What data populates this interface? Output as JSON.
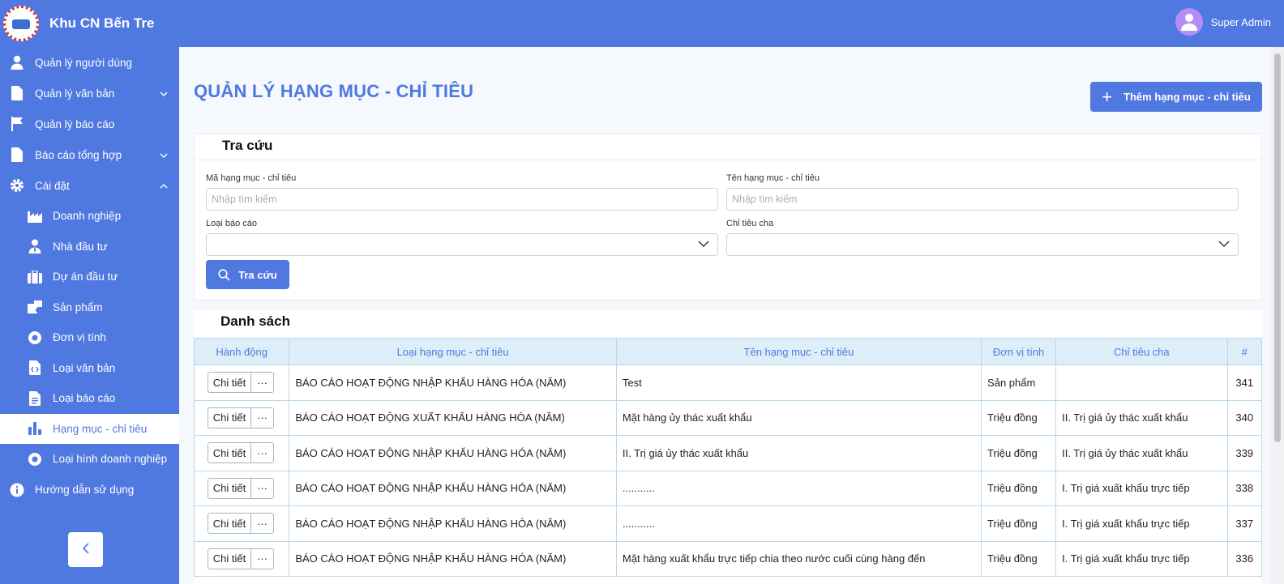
{
  "app": {
    "name": "Khu CN Bến Tre"
  },
  "user": {
    "name": "Super Admin"
  },
  "sidebar": {
    "items": [
      {
        "label": "Quản lý người dùng"
      },
      {
        "label": "Quản lý văn bản"
      },
      {
        "label": "Quản lý báo cáo"
      },
      {
        "label": "Báo cáo tổng hợp"
      },
      {
        "label": "Cài đặt"
      }
    ],
    "sub_items": [
      {
        "label": "Doanh nghiệp"
      },
      {
        "label": "Nhà đầu tư"
      },
      {
        "label": "Dự án đầu tư"
      },
      {
        "label": "Sản phẩm"
      },
      {
        "label": "Đơn vị tính"
      },
      {
        "label": "Loại văn bản"
      },
      {
        "label": "Loại báo cáo"
      },
      {
        "label": "Hạng mục - chỉ tiêu"
      },
      {
        "label": "Loại hình doanh nghiệp"
      }
    ],
    "help": {
      "label": "Hướng dẫn sử dụng"
    }
  },
  "page": {
    "title": "QUẢN LÝ HẠNG MỤC - CHỈ TIÊU",
    "add_label": "Thêm hạng mục - chỉ tiêu"
  },
  "search": {
    "title": "Tra cứu",
    "code_label": "Mã hạng mục - chỉ tiêu",
    "code_placeholder": "Nhập tìm kiếm",
    "name_label": "Tên hạng mục - chỉ tiêu",
    "name_placeholder": "Nhập tìm kiếm",
    "report_type_label": "Loại báo cáo",
    "parent_label": "Chỉ tiêu cha",
    "button_label": "Tra cứu"
  },
  "list": {
    "title": "Danh sách",
    "columns": [
      "Hành động",
      "Loại hạng mục - chỉ tiêu",
      "Tên hạng mục - chỉ tiêu",
      "Đơn vị tính",
      "Chỉ tiêu cha",
      "#"
    ],
    "detail_label": "Chi tiết",
    "more_label": "···",
    "rows": [
      {
        "type": "BÁO CÁO HOẠT ĐỘNG NHẬP KHẨU HÀNG HÓA (NĂM)",
        "name": "Test",
        "unit": "Sản phẩm",
        "parent": "",
        "id": "341"
      },
      {
        "type": "BÁO CÁO HOẠT ĐỘNG XUẤT KHẨU HÀNG HÓA (NĂM)",
        "name": "Mặt hàng ủy thác xuất khẩu",
        "unit": "Triệu đồng",
        "parent": "II. Trị giá ủy thác xuất khẩu",
        "id": "340"
      },
      {
        "type": "BÁO CÁO HOẠT ĐỘNG NHẬP KHẨU HÀNG HÓA (NĂM)",
        "name": "II. Trị giá ủy thác xuất khẩu",
        "unit": "Triệu đồng",
        "parent": "II. Trị giá ủy thác xuất khẩu",
        "id": "339"
      },
      {
        "type": "BÁO CÁO HOẠT ĐỘNG NHẬP KHẨU HÀNG HÓA (NĂM)",
        "name": "...........",
        "unit": "Triệu đồng",
        "parent": "I. Trị giá xuất khẩu trực tiếp",
        "id": "338"
      },
      {
        "type": "BÁO CÁO HOẠT ĐỘNG NHẬP KHẨU HÀNG HÓA (NĂM)",
        "name": "...........",
        "unit": "Triệu đồng",
        "parent": "I. Trị giá xuất khẩu trực tiếp",
        "id": "337"
      },
      {
        "type": "BÁO CÁO HOẠT ĐỘNG NHẬP KHẨU HÀNG HÓA (NĂM)",
        "name": "Mặt hàng xuất khẩu trực tiếp chia theo nước cuối cùng hàng đến",
        "unit": "Triệu đồng",
        "parent": "I. Trị giá xuất khẩu trực tiếp",
        "id": "336"
      }
    ]
  },
  "colors": {
    "primary": "#4f78e0",
    "header_bg": "#ddeef8"
  }
}
